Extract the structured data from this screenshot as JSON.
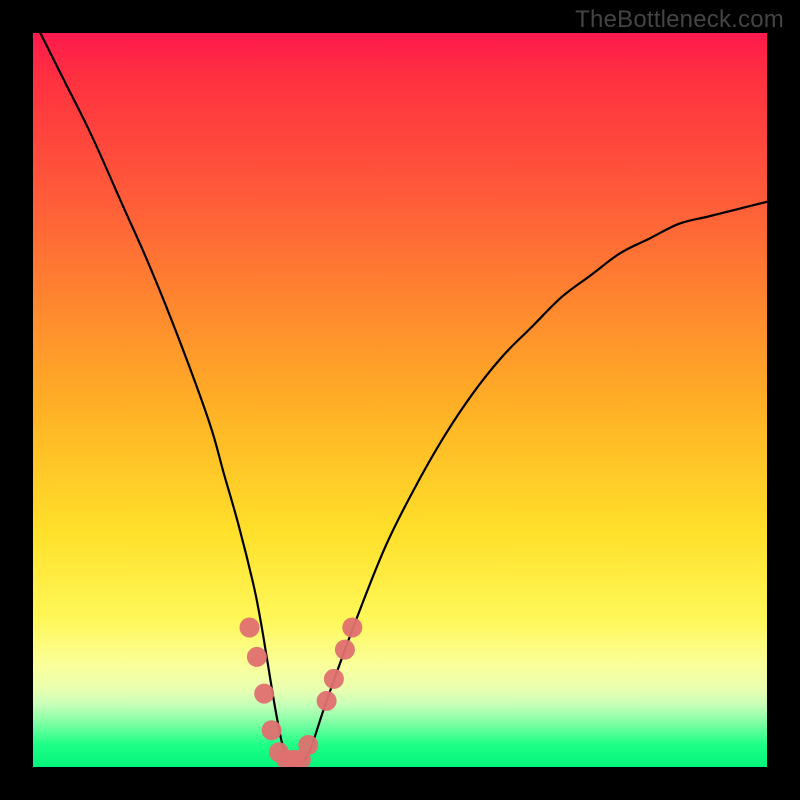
{
  "watermark": "TheBottleneck.com",
  "chart_data": {
    "type": "line",
    "title": "",
    "xlabel": "",
    "ylabel": "",
    "xlim": [
      0,
      100
    ],
    "ylim": [
      0,
      100
    ],
    "legend": false,
    "grid": false,
    "curve": {
      "name": "bottleneck-curve",
      "x": [
        0,
        4,
        8,
        12,
        16,
        20,
        24,
        26,
        28,
        30,
        31,
        32,
        33,
        34,
        35,
        36,
        37,
        38,
        40,
        44,
        48,
        52,
        56,
        60,
        64,
        68,
        72,
        76,
        80,
        84,
        88,
        92,
        96,
        100
      ],
      "y": [
        102,
        94,
        86,
        77,
        68,
        58,
        47,
        40,
        33,
        25,
        20,
        14,
        8,
        3,
        1,
        1,
        1,
        3,
        9,
        20,
        30,
        38,
        45,
        51,
        56,
        60,
        64,
        67,
        70,
        72,
        74,
        75,
        76,
        77
      ]
    },
    "markers": {
      "name": "marker-dots",
      "color": "#e07070",
      "points": [
        {
          "x": 29.5,
          "y": 19
        },
        {
          "x": 30.5,
          "y": 15
        },
        {
          "x": 31.5,
          "y": 10
        },
        {
          "x": 32.5,
          "y": 5
        },
        {
          "x": 33.5,
          "y": 2
        },
        {
          "x": 34.5,
          "y": 1
        },
        {
          "x": 35.5,
          "y": 1
        },
        {
          "x": 36.5,
          "y": 1
        },
        {
          "x": 37.5,
          "y": 3
        },
        {
          "x": 40.0,
          "y": 9
        },
        {
          "x": 41.0,
          "y": 12
        },
        {
          "x": 42.5,
          "y": 16
        },
        {
          "x": 43.5,
          "y": 19
        }
      ]
    }
  }
}
